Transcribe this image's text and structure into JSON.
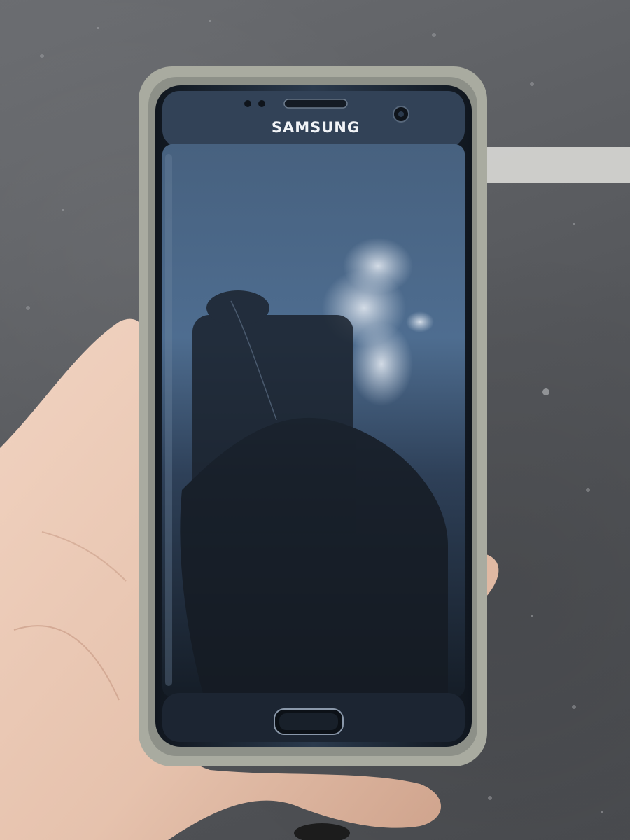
{
  "phone": {
    "brand": "SAMSUNG"
  },
  "colors": {
    "asphalt": "#5d5f63",
    "case": "#a9aba0",
    "phone_body": "#2a3442",
    "screen_glass": "#1d2733",
    "sky_reflection": "#5a7796",
    "skin": "#e9c8b4"
  }
}
